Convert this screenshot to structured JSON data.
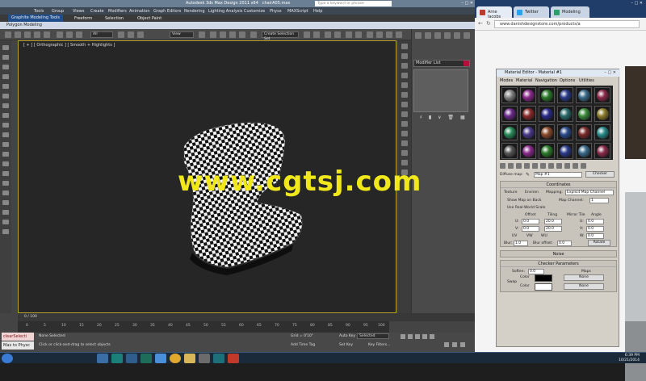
{
  "max": {
    "window_title": "Autodesk 3ds Max Design 2011 x64",
    "file_name": "chairA05.max",
    "search_placeholder": "Type a keyword or phrase",
    "menu": [
      "Tools",
      "Group",
      "Views",
      "Create",
      "Modifiers",
      "Animation",
      "Graph Editors",
      "Rendering",
      "Lighting Analysis",
      "Customize",
      "Physx",
      "MAXScript",
      "Help"
    ],
    "ribbon_tabs": [
      "Graphite Modeling Tools",
      "Freeform",
      "Selection",
      "Object Paint"
    ],
    "ribbon_active": "Graphite Modeling Tools",
    "polygon_modeling": "Polygon Modeling",
    "toolbar": {
      "filter_select": "All",
      "coord_select": "View",
      "selection_set": "Create Selection Set"
    },
    "viewport_label": "[ + ] [ Orthographic ] [ Smooth + Highlights ]",
    "modifier_list": "Modifier List",
    "time_slider": "0 / 100",
    "ruler_ticks": [
      "0",
      "5",
      "10",
      "15",
      "20",
      "25",
      "30",
      "35",
      "40",
      "45",
      "50",
      "55",
      "60",
      "65",
      "70",
      "75",
      "80",
      "85",
      "90",
      "95",
      "100"
    ],
    "status": {
      "maxscript_line1": "clearSelecti",
      "maxscript_line2": "Max to Physc",
      "none_selected": "None Selected",
      "prompt": "Click or click-and-drag to select objects",
      "grid": "Grid = 0'10\"",
      "auto_key": "Auto Key",
      "auto_key_value": "Selected",
      "set_key": "Set Key",
      "key_filters": "Key Filters...",
      "add_time_tag": "Add Time Tag"
    }
  },
  "watermark": "www.cgtsj.com",
  "browser": {
    "tabs": [
      "Arne Jacobs",
      "Twitter",
      "Modeling"
    ],
    "address": "www.danishdesignstore.com/products/a"
  },
  "material_editor": {
    "title": "Material Editor - Material #1",
    "menu": [
      "Modes",
      "Material",
      "Navigation",
      "Options",
      "Utilities"
    ],
    "diffuse_label": "Diffuse map:",
    "map_name": "Map #1",
    "map_type": "Checker",
    "coordinates_title": "Coordinates",
    "texture": "Texture",
    "environ": "Environ",
    "mapping_label": "Mapping:",
    "mapping_value": "Explicit Map Channel",
    "show_map_on_back": "Show Map on Back",
    "map_channel_label": "Map Channel:",
    "map_channel_value": "1",
    "real_world_scale": "Use Real-World Scale",
    "offset_label": "Offset",
    "tiling_label": "Tiling",
    "mirror_tile_label": "Mirror Tile",
    "angle_label": "Angle",
    "u": "U:",
    "v": "V:",
    "w": "W:",
    "u_offset": "0.0",
    "u_tiling": "20.0",
    "v_offset": "0.0",
    "v_tiling": "20.0",
    "u_angle": "0.0",
    "v_angle": "0.0",
    "w_angle": "0.0",
    "uv": "UV",
    "vw": "VW",
    "wu": "WU",
    "blur_label": "Blur:",
    "blur_value": "1.0",
    "blur_offset_label": "Blur offset:",
    "blur_offset_value": "0.0",
    "rotate": "Rotate",
    "noise_title": "Noise",
    "checker_title": "Checker Parameters",
    "soften_label": "Soften:",
    "soften_value": "0.0",
    "maps_label": "Maps",
    "swap": "Swap",
    "color_label": "Color",
    "none": "None"
  },
  "taskbar": {
    "time": "6:39 PM",
    "date": "10/21/2014"
  }
}
